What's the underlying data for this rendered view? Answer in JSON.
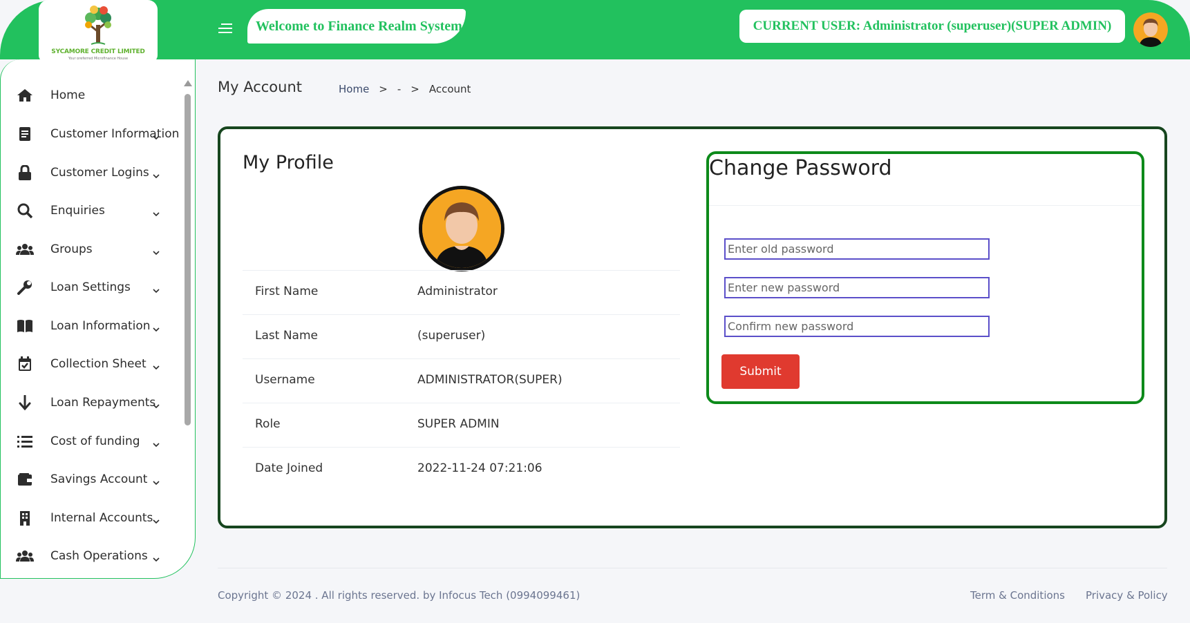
{
  "header": {
    "logo_name": "SYCAMORE CREDIT LIMITED",
    "logo_tagline": "Your preferred Microfinance House",
    "welcome": "Welcome to Finance Realm System",
    "current_user": "CURRENT USER: Administrator (superuser)(SUPER ADMIN)"
  },
  "sidebar": {
    "items": [
      {
        "label": "Home",
        "icon": "home-icon"
      },
      {
        "label": "Customer Information",
        "icon": "document-icon"
      },
      {
        "label": "Customer Logins",
        "icon": "lock-icon"
      },
      {
        "label": "Enquiries",
        "icon": "search-icon"
      },
      {
        "label": "Groups",
        "icon": "users-icon"
      },
      {
        "label": "Loan Settings",
        "icon": "wrench-icon"
      },
      {
        "label": "Loan Information",
        "icon": "book-icon"
      },
      {
        "label": "Collection Sheet",
        "icon": "calendar-check-icon"
      },
      {
        "label": "Loan Repayments",
        "icon": "arrow-down-icon"
      },
      {
        "label": "Cost of funding",
        "icon": "list-icon"
      },
      {
        "label": "Savings Account",
        "icon": "wallet-icon"
      },
      {
        "label": "Internal Accounts",
        "icon": "building-icon"
      },
      {
        "label": "Cash Operations",
        "icon": "users-icon"
      }
    ]
  },
  "breadcrumb": {
    "page_title": "My Account",
    "home": "Home",
    "sep1": ">",
    "dash": "-",
    "sep2": ">",
    "current": "Account"
  },
  "profile": {
    "title": "My Profile",
    "rows": [
      {
        "label": "First Name",
        "value": "Administrator"
      },
      {
        "label": "Last Name",
        "value": "(superuser)"
      },
      {
        "label": "Username",
        "value": "ADMINISTRATOR(SUPER)"
      },
      {
        "label": "Role",
        "value": "SUPER ADMIN"
      },
      {
        "label": "Date Joined",
        "value": "2022-11-24 07:21:06"
      }
    ]
  },
  "password": {
    "title": "Change Password",
    "old_placeholder": "Enter old password",
    "new_placeholder": "Enter new password",
    "confirm_placeholder": "Confirm new password",
    "submit": "Submit"
  },
  "footer": {
    "copyright": "Copyright © 2024 . All rights reserved. by Infocus Tech (0994099461)",
    "terms": "Term & Conditions",
    "privacy": "Privacy & Policy"
  },
  "colors": {
    "brand_green": "#22c15e",
    "card_border": "#17461f",
    "password_border": "#0d8a1a",
    "submit_red": "#e03a2f"
  }
}
